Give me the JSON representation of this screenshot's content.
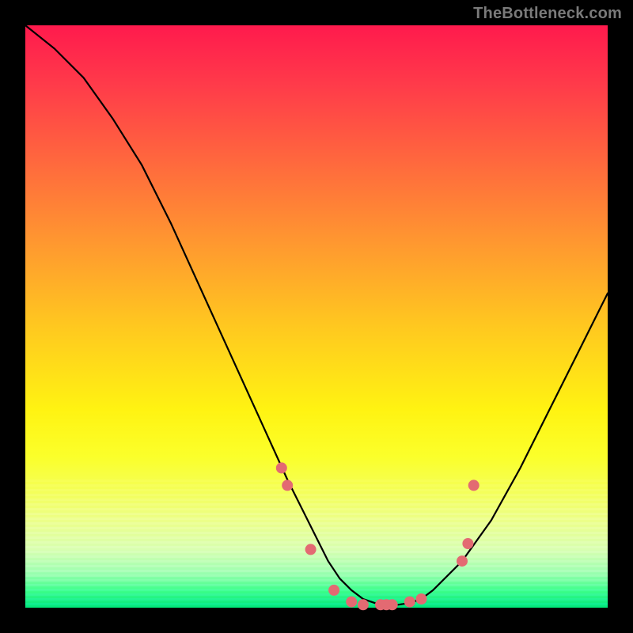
{
  "watermark": "TheBottleneck.com",
  "chart_data": {
    "type": "line",
    "title": "",
    "xlabel": "",
    "ylabel": "",
    "xlim": [
      0,
      100
    ],
    "ylim": [
      0,
      100
    ],
    "x": [
      0,
      5,
      10,
      15,
      20,
      25,
      30,
      35,
      40,
      45,
      50,
      52,
      54,
      56,
      58,
      60,
      62,
      64,
      66,
      68,
      70,
      75,
      80,
      85,
      90,
      95,
      100
    ],
    "y": [
      100,
      96,
      91,
      84,
      76,
      66,
      55,
      44,
      33,
      22,
      12,
      8,
      5,
      3,
      1.5,
      0.8,
      0.5,
      0.5,
      0.8,
      1.5,
      3,
      8,
      15,
      24,
      34,
      44,
      54
    ],
    "markers": {
      "x": [
        44,
        45,
        49,
        53,
        56,
        58,
        61,
        62,
        63,
        66,
        68,
        75,
        76,
        77
      ],
      "y": [
        24,
        21,
        10,
        3,
        1,
        0.5,
        0.5,
        0.5,
        0.5,
        1,
        1.5,
        8,
        11,
        21
      ]
    },
    "marker_color": "#e36a72",
    "line_color": "#000000"
  }
}
